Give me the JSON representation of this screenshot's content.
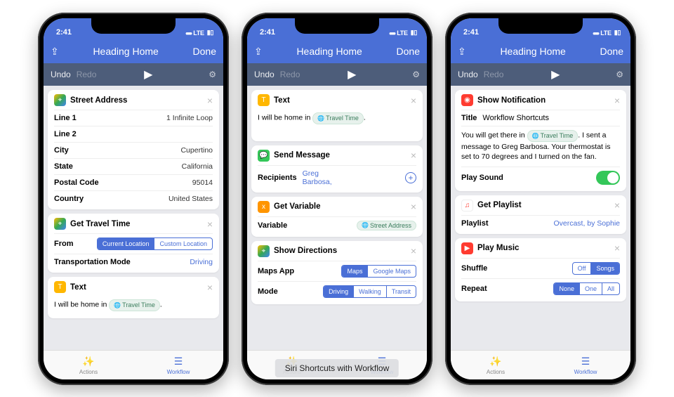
{
  "caption": "Siri Shortcuts with Workflow",
  "statusbar": {
    "time": "2:41"
  },
  "navbar": {
    "title": "Heading Home",
    "done": "Done"
  },
  "toolbar": {
    "undo": "Undo",
    "redo": "Redo"
  },
  "tabs": {
    "actions": "Actions",
    "workflow": "Workflow"
  },
  "screen1": {
    "address": {
      "title": "Street Address",
      "rows": [
        {
          "label": "Line 1",
          "value": "1 Infinite Loop"
        },
        {
          "label": "Line 2",
          "value": ""
        },
        {
          "label": "City",
          "value": "Cupertino"
        },
        {
          "label": "State",
          "value": "California"
        },
        {
          "label": "Postal Code",
          "value": "95014"
        },
        {
          "label": "Country",
          "value": "United States"
        }
      ]
    },
    "travel": {
      "title": "Get Travel Time",
      "from": "From",
      "seg": [
        "Current Location",
        "Custom Location"
      ],
      "mode_label": "Transportation Mode",
      "mode_value": "Driving"
    },
    "text": {
      "title": "Text",
      "prefix": "I will be home in ",
      "chip": "Travel Time",
      "suffix": "."
    }
  },
  "screen2": {
    "text": {
      "title": "Text",
      "prefix": "I will be home in ",
      "chip": "Travel Time",
      "suffix": "."
    },
    "send": {
      "title": "Send Message",
      "recipients_label": "Recipients",
      "recipients_value": "Greg Barbosa,"
    },
    "getvar": {
      "title": "Get Variable",
      "var_label": "Variable",
      "var_chip": "Street Address"
    },
    "dirs": {
      "title": "Show Directions",
      "maps_label": "Maps App",
      "maps_seg": [
        "Maps",
        "Google Maps"
      ],
      "mode_label": "Mode",
      "mode_seg": [
        "Driving",
        "Walking",
        "Transit"
      ]
    }
  },
  "screen3": {
    "notif": {
      "title": "Show Notification",
      "title_label": "Title",
      "title_value": "Workflow Shortcuts",
      "body_prefix": "You will get there in ",
      "body_chip": "Travel Time",
      "body_suffix": ". I sent a message to Greg Barbosa. Your thermostat is set to 70 degrees and I turned on the fan.",
      "sound_label": "Play Sound"
    },
    "playlist": {
      "title": "Get Playlist",
      "label": "Playlist",
      "value": "Overcast, by Sophie"
    },
    "music": {
      "title": "Play Music",
      "shuffle_label": "Shuffle",
      "shuffle_seg": [
        "Off",
        "Songs"
      ],
      "repeat_label": "Repeat",
      "repeat_seg": [
        "None",
        "One",
        "All"
      ]
    }
  }
}
